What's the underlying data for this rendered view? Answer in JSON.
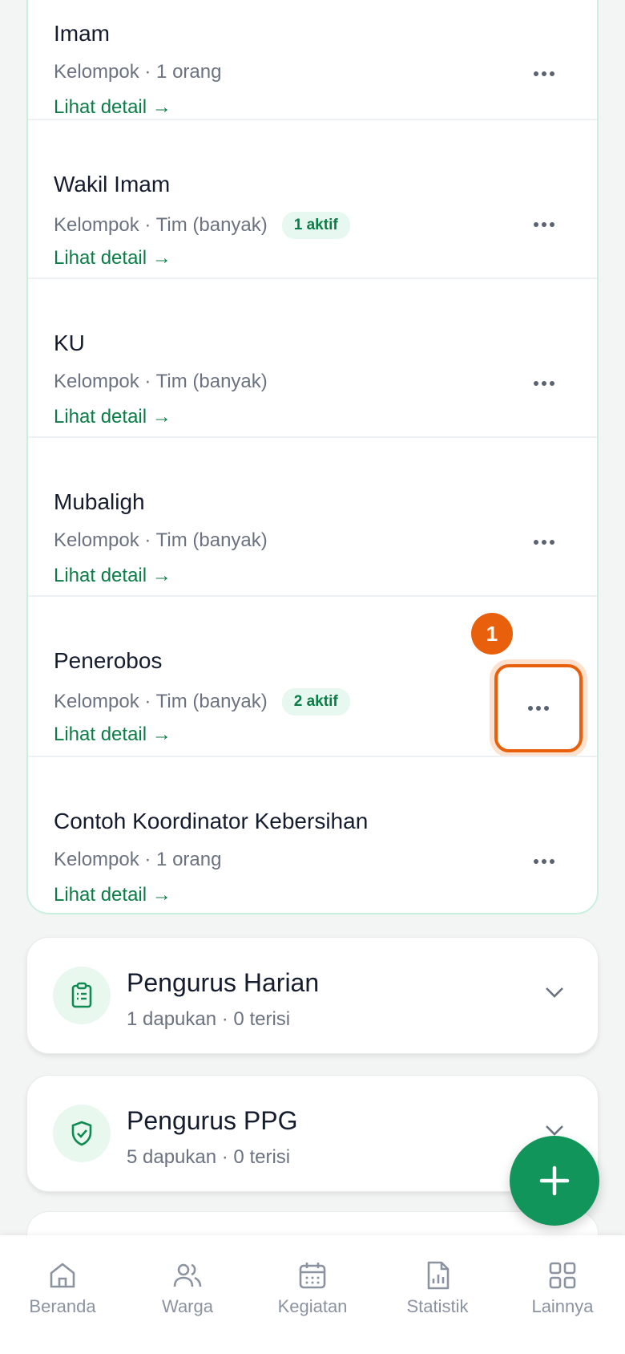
{
  "roles": [
    {
      "name": "Imam",
      "meta": "Kelompok · 1 orang",
      "badge": "",
      "link": "Lihat detail →"
    },
    {
      "name": "Wakil Imam",
      "meta": "Kelompok · Tim (banyak)",
      "badge": "1 aktif",
      "link": "Lihat detail →"
    },
    {
      "name": "KU",
      "meta": "Kelompok · Tim (banyak)",
      "badge": "",
      "link": "Lihat detail →"
    },
    {
      "name": "Mubaligh",
      "meta": "Kelompok · Tim (banyak)",
      "badge": "",
      "link": "Lihat detail →"
    },
    {
      "name": "Penerobos",
      "meta": "Kelompok · Tim (banyak)",
      "badge": "2 aktif",
      "link": "Lihat detail →"
    },
    {
      "name": "Contoh Koordinator Kebersihan",
      "meta": "Kelompok · 1 orang",
      "badge": "",
      "link": "Lihat detail →"
    }
  ],
  "marker": "1",
  "sections": [
    {
      "title": "Pengurus Harian",
      "sub": "1 dapukan · 0 terisi",
      "icon": "clipboard-icon"
    },
    {
      "title": "Pengurus PPG",
      "sub": "5 dapukan · 0 terisi",
      "icon": "shield-check-icon"
    }
  ],
  "nav": [
    {
      "label": "Beranda",
      "icon": "home-icon"
    },
    {
      "label": "Warga",
      "icon": "users-icon"
    },
    {
      "label": "Kegiatan",
      "icon": "calendar-icon"
    },
    {
      "label": "Statistik",
      "icon": "report-icon"
    },
    {
      "label": "Lainnya",
      "icon": "grid-icon"
    }
  ],
  "colors": {
    "accent": "#11955a",
    "link": "#0b7d47",
    "highlight": "#e8600b"
  }
}
